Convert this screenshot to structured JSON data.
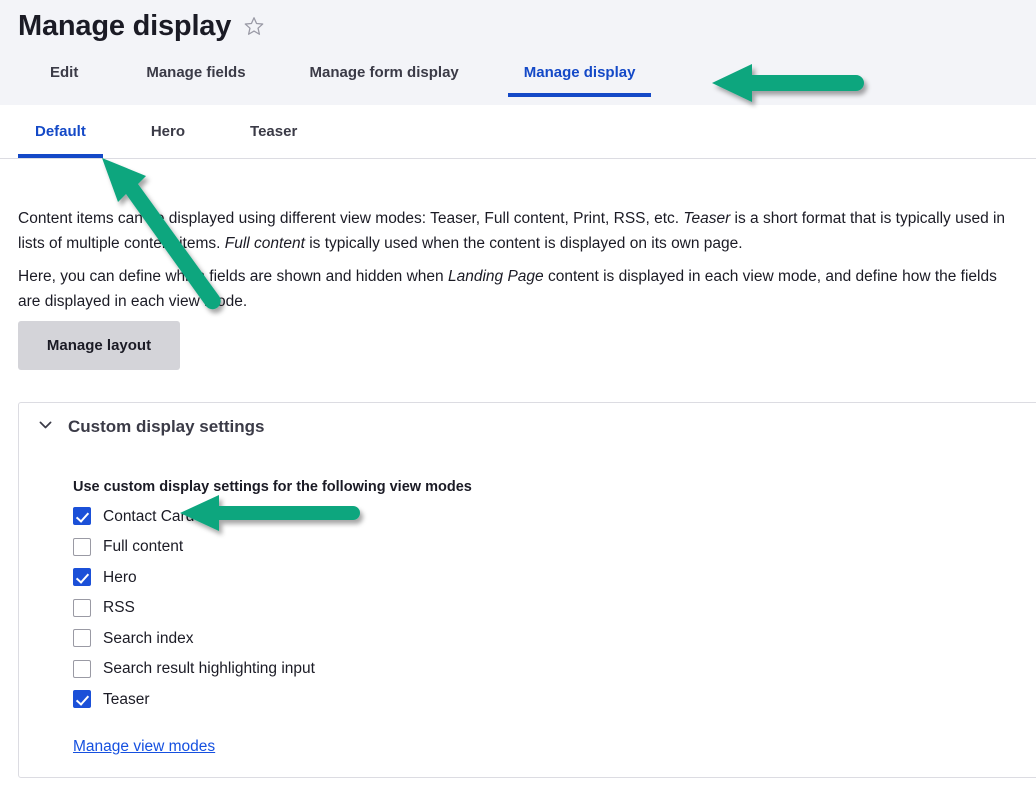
{
  "header": {
    "title": "Manage display",
    "favorite_icon": "star-icon"
  },
  "primary_tabs": [
    {
      "label": "Edit",
      "active": false
    },
    {
      "label": "Manage fields",
      "active": false
    },
    {
      "label": "Manage form display",
      "active": false
    },
    {
      "label": "Manage display",
      "active": true
    }
  ],
  "secondary_tabs": [
    {
      "label": "Default",
      "active": true
    },
    {
      "label": "Hero",
      "active": false
    },
    {
      "label": "Teaser",
      "active": false
    }
  ],
  "description": {
    "paragraph1_part1": "Content items can be displayed using different view modes: Teaser, Full content, Print, RSS, etc. ",
    "paragraph1_em1": "Teaser",
    "paragraph1_part2": " is a short format that is typically used in lists of multiple content items. ",
    "paragraph1_em2": "Full content",
    "paragraph1_part3": " is typically used when the content is displayed on its own page.",
    "paragraph2_part1": "Here, you can define which fields are shown and hidden when ",
    "paragraph2_em1": "Landing Page",
    "paragraph2_part2": " content is displayed in each view mode, and define how the fields are displayed in each view mode."
  },
  "manage_layout_button": {
    "label": "Manage layout"
  },
  "custom_display_settings": {
    "summary_label": "Custom display settings",
    "toggle_icon": "chevron-down-icon",
    "legend": "Use custom display settings for the following view modes",
    "view_modes": [
      {
        "label": "Contact Card",
        "checked": true
      },
      {
        "label": "Full content",
        "checked": false
      },
      {
        "label": "Hero",
        "checked": true
      },
      {
        "label": "RSS",
        "checked": false
      },
      {
        "label": "Search index",
        "checked": false
      },
      {
        "label": "Search result highlighting input",
        "checked": false
      },
      {
        "label": "Teaser",
        "checked": true
      }
    ],
    "manage_view_modes_link": "Manage view modes"
  },
  "annotations": {
    "arrow_color": "#0aa67e",
    "arrows": [
      {
        "name": "arrow-to-manage-display-tab",
        "target": "Manage display"
      },
      {
        "name": "arrow-to-default-subtab",
        "target": "Default"
      },
      {
        "name": "arrow-to-contact-card-checkbox",
        "target": "Contact Card"
      }
    ]
  },
  "colors": {
    "header_background": "#f3f4f8",
    "active_tab": "#1449c7",
    "checkbox_checked": "#1b50d8",
    "link": "#1550e0",
    "button_background": "#d4d4d9"
  }
}
